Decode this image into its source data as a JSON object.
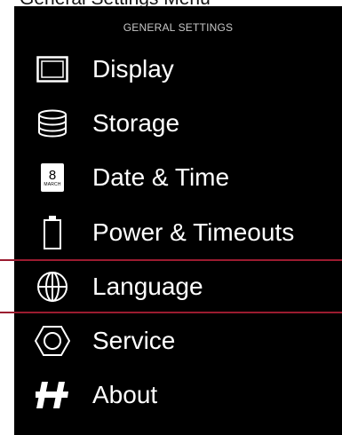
{
  "caption": "General Settings Menu",
  "header": {
    "title": "GENERAL SETTINGS"
  },
  "accent": "#9b1b30",
  "menu": {
    "items": [
      {
        "label": "Display",
        "icon": "display-icon"
      },
      {
        "label": "Storage",
        "icon": "storage-icon"
      },
      {
        "label": "Date & Time",
        "icon": "calendar-icon",
        "icon_day": "8",
        "icon_month": "MARCH"
      },
      {
        "label": "Power & Timeouts",
        "icon": "battery-icon"
      },
      {
        "label": "Language",
        "icon": "globe-icon",
        "selected": true
      },
      {
        "label": "Service",
        "icon": "hex-nut-icon"
      },
      {
        "label": "About",
        "icon": "hasselblad-h-icon"
      }
    ]
  }
}
